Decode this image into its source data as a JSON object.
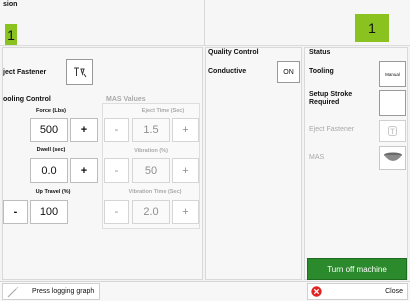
{
  "header": {
    "title_partial": "sion",
    "left_counter": "1",
    "right_counter": "1",
    "accent_green": "#8ac320"
  },
  "fastener": {
    "label": "ject Fastener",
    "icon": "fastener-tool-icon"
  },
  "tooling_control": {
    "title": "ooling Control",
    "force": {
      "label": "Force (Lbs)",
      "value": "500",
      "plus": "+"
    },
    "dwell": {
      "label": "Dwell (sec)",
      "value": "0.0",
      "plus": "+"
    },
    "up_travel": {
      "label": "Up Travel (%)",
      "value": "100",
      "minus": "-"
    }
  },
  "mas_values": {
    "title": "MAS Values",
    "eject_time": {
      "label": "Eject Time (Sec)",
      "value": "1.5",
      "minus": "-",
      "plus": "+"
    },
    "vibration": {
      "label": "Vibration (%)",
      "value": "50",
      "minus": "-",
      "plus": "+"
    },
    "vibration_time": {
      "label": "Vibration Time (Sec)",
      "value": "2.0",
      "minus": "-",
      "plus": "+"
    }
  },
  "quality_control": {
    "title": "Quality Control",
    "conductive_label": "Conductive",
    "conductive_button": "ON"
  },
  "status": {
    "title": "Status",
    "tooling_label": "Tooling",
    "tooling_button": "Manual",
    "setup_stroke_label": "Setup Stroke Required",
    "eject_fastener_label": "Eject Fastener",
    "mas_label": "MAS"
  },
  "actions": {
    "turn_off": "Turn off machine",
    "press_logging": "Press logging graph",
    "close": "Close",
    "turn_off_color": "#2b8a2b",
    "close_icon_color": "#e02424"
  }
}
